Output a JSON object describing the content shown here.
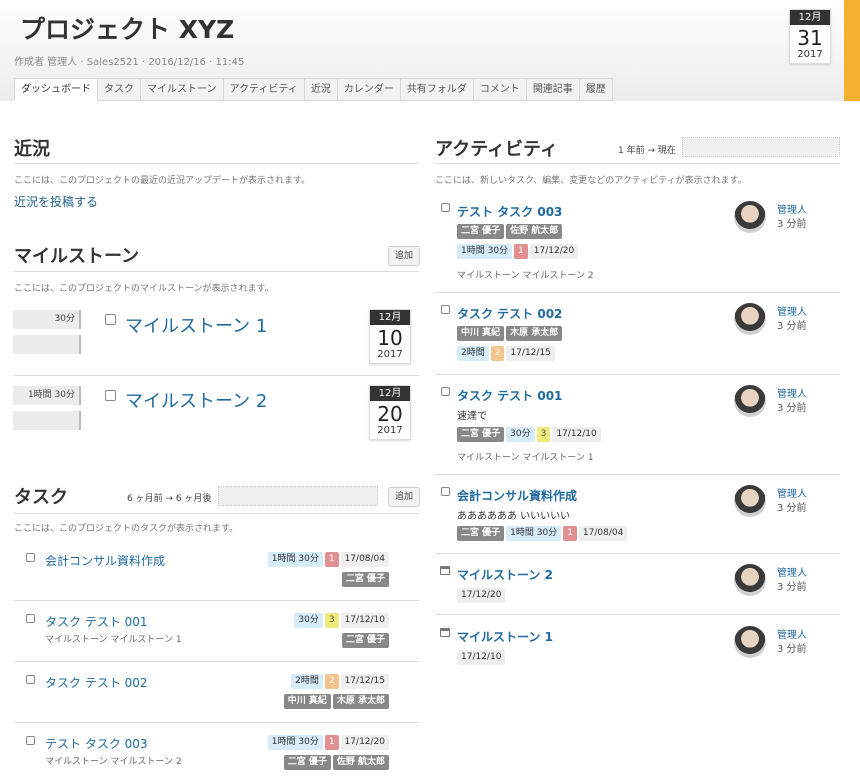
{
  "project": {
    "title": "プロジェクト XYZ",
    "meta": "作成者 管理人 · Sales2521 · 2016/12/16 · 11:45",
    "due": {
      "month": "12月",
      "day": "31",
      "year": "2017"
    }
  },
  "tabs": [
    "ダッシュボード",
    "タスク",
    "マイルストーン",
    "アクティビティ",
    "近況",
    "カレンダー",
    "共有フォルダ",
    "コメント",
    "関連記事",
    "履歴"
  ],
  "updates": {
    "title": "近況",
    "desc": "ここには、このプロジェクトの最近の近況アップデートが表示されます。",
    "post_link": "近況を投稿する"
  },
  "milestones": {
    "title": "マイルストーン",
    "add": "追加",
    "desc": "ここには、このプロジェクトのマイルストーンが表示されます。",
    "items": [
      {
        "time": "30分",
        "name": "マイルストーン 1",
        "month": "12月",
        "day": "10",
        "year": "2017",
        "progress": 0
      },
      {
        "time": "1時間 30分",
        "name": "マイルストーン 2",
        "month": "12月",
        "day": "20",
        "year": "2017",
        "progress": 0
      }
    ]
  },
  "tasks": {
    "title": "タスク",
    "range": "6 ヶ月前 → 6 ヶ月後",
    "add": "追加",
    "desc": "ここには、このプロジェクトのタスクが表示されます。",
    "items": [
      {
        "name": "会計コンサル資料作成",
        "sub": "",
        "time": "1時間 30分",
        "priority": "1",
        "date": "17/08/04",
        "users": [
          "二宮 優子"
        ]
      },
      {
        "name": "タスク テスト 001",
        "sub": "マイルストーン マイルストーン 1",
        "time": "30分",
        "priority": "3",
        "date": "17/12/10",
        "users": [
          "二宮 優子"
        ]
      },
      {
        "name": "タスク テスト 002",
        "sub": "",
        "time": "2時間",
        "priority": "2",
        "date": "17/12/15",
        "users": [
          "中川 真紀",
          "木原 承太郎"
        ]
      },
      {
        "name": "テスト タスク 003",
        "sub": "マイルストーン マイルストーン 2",
        "time": "1時間 30分",
        "priority": "1",
        "date": "17/12/20",
        "users": [
          "二宮 優子",
          "佐野 航太郎"
        ]
      }
    ]
  },
  "activity": {
    "title": "アクティビティ",
    "range": "1 年前 → 現在",
    "desc": "ここには、新しいタスク、編集、変更などのアクティビティが表示されます。",
    "items": [
      {
        "title": "テスト タスク 003",
        "text": "",
        "users": [
          "二宮 優子",
          "佐野 航太郎"
        ],
        "time": "1時間 30分",
        "priority": "1",
        "date": "17/12/20",
        "sub": "マイルストーン マイルストーン 2",
        "who": "管理人",
        "ago": "3 分前"
      },
      {
        "title": "タスク テスト 002",
        "text": "",
        "users": [
          "中川 真紀",
          "木原 承太郎"
        ],
        "time": "2時間",
        "priority": "2",
        "date": "17/12/15",
        "sub": "",
        "who": "管理人",
        "ago": "3 分前"
      },
      {
        "title": "タスク テスト 001",
        "text": "速達で",
        "users": [
          "二宮 優子"
        ],
        "time": "30分",
        "priority": "3",
        "date": "17/12/10",
        "sub": "マイルストーン マイルストーン 1",
        "who": "管理人",
        "ago": "3 分前"
      },
      {
        "title": "会計コンサル資料作成",
        "text": "ああああああ いいいいい",
        "users": [
          "二宮 優子"
        ],
        "time": "1時間 30分",
        "priority": "1",
        "date": "17/08/04",
        "sub": "",
        "who": "管理人",
        "ago": "3 分前"
      },
      {
        "title": "マイルストーン 2",
        "date": "17/12/20",
        "who": "管理人",
        "ago": "3 分前"
      },
      {
        "title": "マイルストーン 1",
        "date": "17/12/10",
        "who": "管理人",
        "ago": "3 分前"
      }
    ]
  }
}
